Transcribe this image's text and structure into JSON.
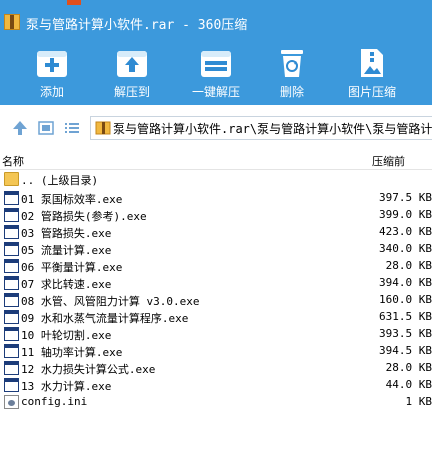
{
  "window": {
    "title": "泵与管路计算小软件.rar - 360压缩"
  },
  "toolbar": {
    "add_label": "添加",
    "extract_to_label": "解压到",
    "one_click_extract_label": "一键解压",
    "delete_label": "删除",
    "image_compress_label": "图片压缩"
  },
  "nav": {
    "path": "泵与管路计算小软件.rar\\泵与管路计算小软件\\泵与管路计算小"
  },
  "columns": {
    "name": "名称",
    "compressed_size": "压缩前"
  },
  "files": [
    {
      "name": "..  (上级目录)",
      "size": "",
      "type": "folder"
    },
    {
      "name": "01  泵国标效率.exe",
      "size": "397.5 KB",
      "type": "exe"
    },
    {
      "name": "02  管路损失(参考).exe",
      "size": "399.0 KB",
      "type": "exe"
    },
    {
      "name": "03  管路损失.exe",
      "size": "423.0 KB",
      "type": "exe"
    },
    {
      "name": "05  流量计算.exe",
      "size": "340.0 KB",
      "type": "exe"
    },
    {
      "name": "06  平衡量计算.exe",
      "size": "28.0 KB",
      "type": "exe"
    },
    {
      "name": "07  求比转速.exe",
      "size": "394.0 KB",
      "type": "exe"
    },
    {
      "name": "08  水管、风管阻力计算 v3.0.exe",
      "size": "160.0 KB",
      "type": "exe"
    },
    {
      "name": "09  水和水蒸气流量计算程序.exe",
      "size": "631.5 KB",
      "type": "exe"
    },
    {
      "name": "10  叶轮切割.exe",
      "size": "393.5 KB",
      "type": "exe"
    },
    {
      "name": "11  轴功率计算.exe",
      "size": "394.5 KB",
      "type": "exe"
    },
    {
      "name": "12  水力损失计算公式.exe",
      "size": "28.0 KB",
      "type": "exe"
    },
    {
      "name": "13  水力计算.exe",
      "size": "44.0 KB",
      "type": "exe"
    },
    {
      "name": "config.ini",
      "size": "1 KB",
      "type": "ini"
    }
  ]
}
